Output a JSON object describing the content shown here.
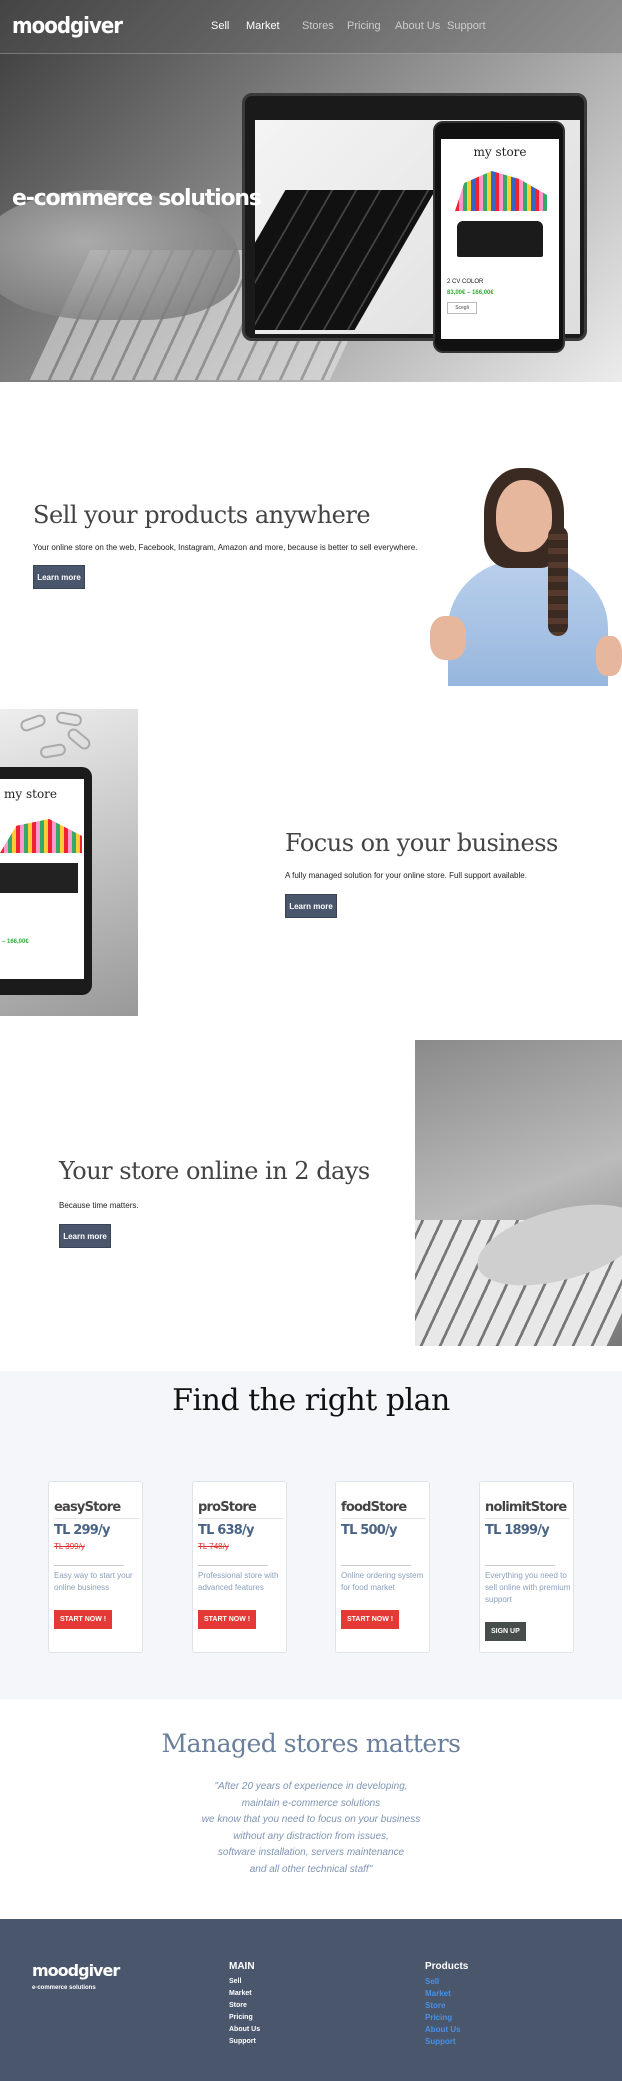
{
  "brand": "moodgiver",
  "nav": [
    "Sell",
    "Market",
    "Stores",
    "Pricing",
    "About Us",
    "Support"
  ],
  "hero": {
    "title": "e-commerce solutions",
    "phone": {
      "title": "my store",
      "product": "2 CV COLOR",
      "price": "83,00€ – 166,00€",
      "button": "Scegli"
    }
  },
  "sections": [
    {
      "title": "Sell your products anywhere",
      "desc": "Your online store on the web, Facebook, Instagram, Amazon and more, because is better to sell everywhere.",
      "button": "Learn more"
    },
    {
      "title": "Focus on your business",
      "desc": "A fully managed solution for your online store. Full support available.",
      "button": "Learn more",
      "img_title": "my store",
      "img_price": "– 166,00€"
    },
    {
      "title": "Your store online in 2 days",
      "desc": "Because time matters.",
      "button": "Learn more"
    }
  ],
  "plans": {
    "title": "Find the right plan",
    "items": [
      {
        "name": "easyStore",
        "price": "TL 299/y",
        "old": "TL 399/y",
        "desc": "Easy way to start your online business",
        "button": "START NOW !"
      },
      {
        "name": "proStore",
        "price": "TL 638/y",
        "old": "TL 748/y",
        "desc": "Professional store  with advanced features",
        "button": "START NOW !"
      },
      {
        "name": "foodStore",
        "price": "TL 500/y",
        "old": "",
        "desc": "Online ordering system for food market",
        "button": "START NOW !"
      },
      {
        "name": "nolimitStore",
        "price": "TL 1899/y",
        "old": "",
        "desc": "Everything you need to sell online with premium support",
        "button": "SIGN UP"
      }
    ]
  },
  "managed": {
    "title": "Managed stores matters",
    "quote": [
      "\"After 20 years of experience in developing,",
      "maintain e-commerce solutions",
      "we know that you need to focus on your business",
      "without any distraction from issues,",
      "software installation, servers maintenance",
      "and all other technical staff\""
    ]
  },
  "footer": {
    "brand": "moodgiver",
    "tagline": "e-commerce solutions",
    "main_title": "MAIN",
    "main_links": [
      "Sell",
      "Market",
      "Store",
      "Pricing",
      "About Us",
      "Support"
    ],
    "products_title": "Products",
    "products_links": [
      "Sell",
      "Market",
      "Store",
      "Pricing",
      "About Us",
      "Support"
    ]
  },
  "colors": {
    "button": "#4a566b",
    "accent_red": "#e53935",
    "link_blue": "#4a90e2",
    "footer_bg": "#4a566b",
    "plans_bg": "#f4f6fa"
  }
}
